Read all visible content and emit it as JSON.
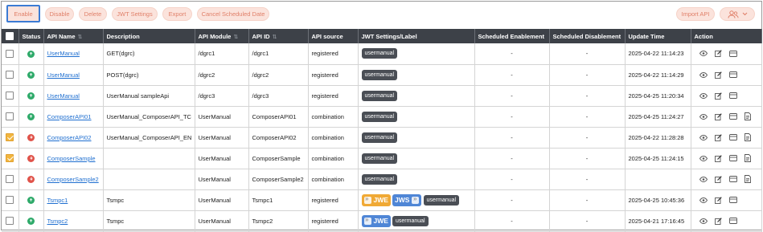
{
  "toolbar": {
    "enable": "Enable",
    "disable": "Disable",
    "delete": "Delete",
    "jwt_settings": "JWT Settings",
    "export": "Export",
    "cancel_scheduled": "Cancel Scheduled Date",
    "import_api": "Import API",
    "user_menu_icon": "users-icon",
    "user_menu_chevron": "chevron-down-icon"
  },
  "colors": {
    "button_bg": "#fbe3dc",
    "button_text": "#e0806a",
    "header_bg": "#3d4148",
    "link": "#1f6fd0",
    "status_enabled": "#2faa6a",
    "status_disabled": "#e0534a",
    "jwe": "#f0a935",
    "jws": "#4f86d6",
    "checkbox_checked": "#f2b63f"
  },
  "table": {
    "headers": {
      "status": "Status",
      "api_name": "API Name",
      "description": "Description",
      "api_module": "API Module",
      "api_id": "API ID",
      "api_source": "API source",
      "jwt": "JWT Settings/Label",
      "sched_enable": "Scheduled Enablement",
      "sched_disable": "Scheduled Disablement",
      "update_time": "Update Time",
      "action": "Action"
    },
    "sort_icon": "sort-icon",
    "rows": [
      {
        "checked": false,
        "status": "enabled",
        "name": "UserManual",
        "description": "GET(dgrc)",
        "module": "/dgrc1",
        "api_id": "/dgrc1",
        "source": "registered",
        "jwe": "",
        "jws": "",
        "label": "usermanual",
        "sched_enable": "-",
        "sched_disable": "-",
        "update_time": "2025-04-22 11:14:23",
        "actions": [
          "view-icon",
          "edit-icon",
          "card-icon"
        ]
      },
      {
        "checked": false,
        "status": "enabled",
        "name": "UserManual",
        "description": "POST(dgrc)",
        "module": "/dgrc2",
        "api_id": "/dgrc2",
        "source": "registered",
        "jwe": "",
        "jws": "",
        "label": "usermanual",
        "sched_enable": "-",
        "sched_disable": "-",
        "update_time": "2025-04-22 11:14:29",
        "actions": [
          "view-icon",
          "edit-icon",
          "card-icon"
        ]
      },
      {
        "checked": false,
        "status": "enabled",
        "name": "UserManual",
        "description": "UserManual sampleApi",
        "module": "/dgrc3",
        "api_id": "/dgrc3",
        "source": "registered",
        "jwe": "",
        "jws": "",
        "label": "usermanual",
        "sched_enable": "-",
        "sched_disable": "-",
        "update_time": "2025-04-25 11:20:34",
        "actions": [
          "view-icon",
          "edit-icon",
          "card-icon"
        ]
      },
      {
        "checked": false,
        "status": "enabled",
        "name": "ComposerAPI01",
        "description": "UserManual_ComposerAPI_TC",
        "module": "UserManual",
        "api_id": "ComposerAPI01",
        "source": "combination",
        "jwe": "",
        "jws": "",
        "label": "usermanual",
        "sched_enable": "-",
        "sched_disable": "-",
        "update_time": "2025-04-25 11:24:27",
        "actions": [
          "view-icon",
          "edit-icon",
          "card-icon",
          "document-icon"
        ]
      },
      {
        "checked": true,
        "status": "disabled",
        "name": "ComposerAPI02",
        "description": "UserManual_ComposerAPI_EN",
        "module": "UserManual",
        "api_id": "ComposerAPI02",
        "source": "combination",
        "jwe": "",
        "jws": "",
        "label": "usermanual",
        "sched_enable": "-",
        "sched_disable": "-",
        "update_time": "2025-04-22 11:28:28",
        "actions": [
          "view-icon",
          "edit-icon",
          "card-icon",
          "document-icon"
        ]
      },
      {
        "checked": true,
        "status": "disabled",
        "name": "ComposerSample",
        "description": "",
        "module": "UserManual",
        "api_id": "ComposerSample",
        "source": "combination",
        "jwe": "",
        "jws": "",
        "label": "usermanual",
        "sched_enable": "-",
        "sched_disable": "-",
        "update_time": "2025-04-25 11:24:15",
        "actions": [
          "view-icon",
          "edit-icon",
          "card-icon",
          "document-icon"
        ]
      },
      {
        "checked": false,
        "status": "disabled",
        "name": "ComposerSample2",
        "description": "",
        "module": "UserManual",
        "api_id": "ComposerSample2",
        "source": "combination",
        "jwe": "",
        "jws": "",
        "label": "usermanual",
        "sched_enable": "-",
        "sched_disable": "-",
        "update_time": "",
        "actions": [
          "view-icon",
          "edit-icon",
          "card-icon",
          "document-icon"
        ]
      },
      {
        "checked": false,
        "status": "enabled",
        "name": "Tsmpc1",
        "description": "Tsmpc",
        "module": "UserManual",
        "api_id": "Tsmpc1",
        "source": "registered",
        "jwe": "JWE",
        "jws": "JWS",
        "label": "usermanual",
        "sched_enable": "-",
        "sched_disable": "-",
        "update_time": "2025-04-25 10:45:36",
        "actions": [
          "view-icon",
          "edit-icon",
          "card-icon"
        ]
      },
      {
        "checked": false,
        "status": "enabled",
        "name": "Tsmpc2",
        "description": "Tsmpc",
        "module": "UserManual",
        "api_id": "Tsmpc2",
        "source": "registered",
        "jwe": "JWE",
        "jws": "",
        "label": "usermanual",
        "sched_enable": "-",
        "sched_disable": "-",
        "update_time": "2025-04-21 17:16:45",
        "actions": [
          "view-icon",
          "edit-icon",
          "card-icon"
        ]
      }
    ]
  }
}
